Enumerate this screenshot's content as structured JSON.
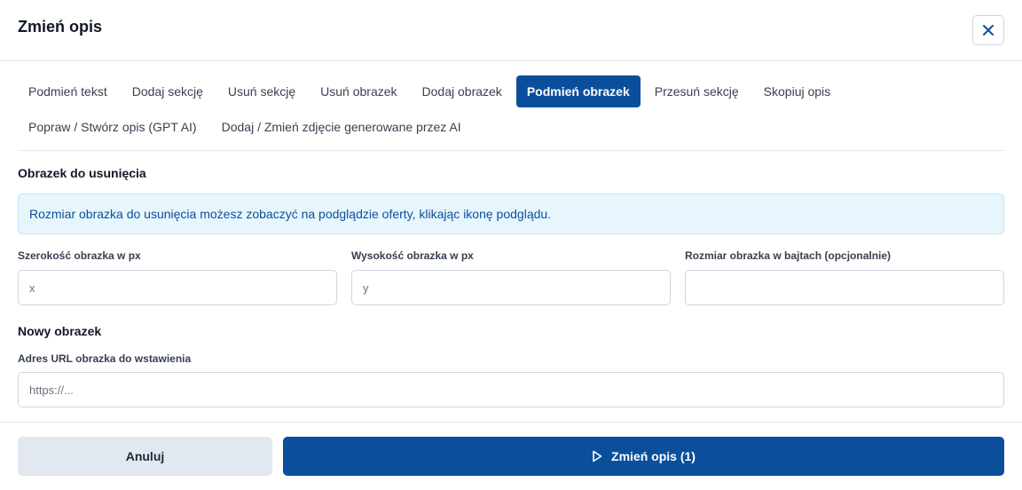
{
  "dialog": {
    "title": "Zmień opis",
    "close_icon": "close-icon"
  },
  "tabs": [
    {
      "label": "Podmień tekst",
      "active": false
    },
    {
      "label": "Dodaj sekcję",
      "active": false
    },
    {
      "label": "Usuń sekcję",
      "active": false
    },
    {
      "label": "Usuń obrazek",
      "active": false
    },
    {
      "label": "Dodaj obrazek",
      "active": false
    },
    {
      "label": "Podmień obrazek",
      "active": true
    },
    {
      "label": "Przesuń sekcję",
      "active": false
    },
    {
      "label": "Skopiuj opis",
      "active": false
    },
    {
      "label": "Popraw / Stwórz opis (GPT AI)",
      "active": false
    },
    {
      "label": "Dodaj / Zmień zdjęcie generowane przez AI",
      "active": false
    }
  ],
  "remove_section": {
    "title": "Obrazek do usunięcia",
    "info": "Rozmiar obrazka do usunięcia możesz zobaczyć na podglądzie oferty, klikając ikonę podglądu.",
    "width": {
      "label": "Szerokość obrazka w px",
      "placeholder": "x",
      "value": ""
    },
    "height": {
      "label": "Wysokość obrazka w px",
      "placeholder": "y",
      "value": ""
    },
    "size": {
      "label": "Rozmiar obrazka w bajtach (opcjonalnie)",
      "placeholder": "",
      "value": ""
    }
  },
  "new_image": {
    "title": "Nowy obrazek",
    "url": {
      "label": "Adres URL obrazka do wstawienia",
      "placeholder": "https://...",
      "value": ""
    }
  },
  "footer": {
    "cancel_label": "Anuluj",
    "submit_label": "Zmień opis (1)",
    "submit_icon": "play-outline-icon"
  },
  "colors": {
    "primary": "#0b4f9c",
    "info_bg": "#e7f6fd",
    "cancel_bg": "#e2e8f0"
  }
}
